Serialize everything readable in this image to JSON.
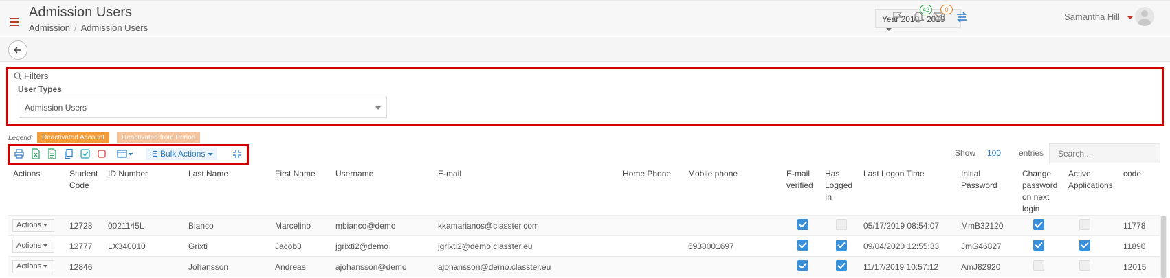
{
  "header": {
    "title": "Admission Users",
    "breadcrumb": [
      "Admission",
      "Admission Users"
    ],
    "year_select": "Year 2018 - 2019",
    "notifications_count": "42",
    "messages_count": "0",
    "user_name": "Samantha Hill"
  },
  "filters": {
    "title": "Filters",
    "user_types_label": "User Types",
    "user_types_value": "Admission Users"
  },
  "legend": {
    "label": "Legend:",
    "deactivated_account": "Deactivated Account",
    "deactivated_period": "Deactivated from Period"
  },
  "toolbar": {
    "bulk_actions": "Bulk Actions",
    "show_label": "Show",
    "show_value": "100",
    "entries_label": "entries",
    "search_placeholder": "Search..."
  },
  "table": {
    "headers": {
      "actions": "Actions",
      "student_code_1": "Student",
      "student_code_2": "Code",
      "id_number": "ID Number",
      "last_name": "Last Name",
      "first_name": "First Name",
      "username": "Username",
      "email": "E-mail",
      "home_phone": "Home Phone",
      "mobile_phone": "Mobile phone",
      "email_verified_1": "E-mail",
      "email_verified_2": "verified",
      "has_logged_1": "Has",
      "has_logged_2": "Logged",
      "has_logged_3": "In",
      "last_logon": "Last Logon Time",
      "initial_password_1": "Initial",
      "initial_password_2": "Password",
      "change_pw_1": "Change",
      "change_pw_2": "password",
      "change_pw_3": "on next",
      "change_pw_4": "login",
      "active_apps_1": "Active",
      "active_apps_2": "Applications",
      "code": "code"
    },
    "actions_label": "Actions",
    "rows": [
      {
        "student_code": "12728",
        "id_number": "0021145L",
        "last_name": "Bianco",
        "first_name": "Marcelino",
        "username": "mbianco@demo",
        "email": "kkamarianos@classter.com",
        "home_phone": "",
        "mobile_phone": "",
        "email_verified": true,
        "has_logged_in": false,
        "last_logon": "05/17/2019 08:54:07",
        "initial_password": "MmB32120",
        "change_password": true,
        "active_applications": false,
        "code": "11778"
      },
      {
        "student_code": "12777",
        "id_number": "LX340010",
        "last_name": "Grixti",
        "first_name": "Jacob3",
        "username": "jgrixti2@demo",
        "email": "jgrixti2@demo.classter.eu",
        "home_phone": "",
        "mobile_phone": "6938001697",
        "email_verified": true,
        "has_logged_in": true,
        "last_logon": "09/04/2020 12:55:33",
        "initial_password": "JmG46827",
        "change_password": true,
        "active_applications": true,
        "code": "11890"
      },
      {
        "student_code": "12846",
        "id_number": "",
        "last_name": "Johansson",
        "first_name": "Andreas",
        "username": "ajohansson@demo",
        "email": "ajohansson@demo.classter.eu",
        "home_phone": "",
        "mobile_phone": "",
        "email_verified": true,
        "has_logged_in": true,
        "last_logon": "11/17/2019 10:57:12",
        "initial_password": "AmJ82920",
        "change_password": false,
        "active_applications": false,
        "code": "12015"
      }
    ]
  },
  "colors": {
    "accent_blue": "#2c7bc6",
    "highlight_red": "#d10000",
    "legend_deactivated": "#f39c3a",
    "legend_period": "#f6c49c"
  }
}
